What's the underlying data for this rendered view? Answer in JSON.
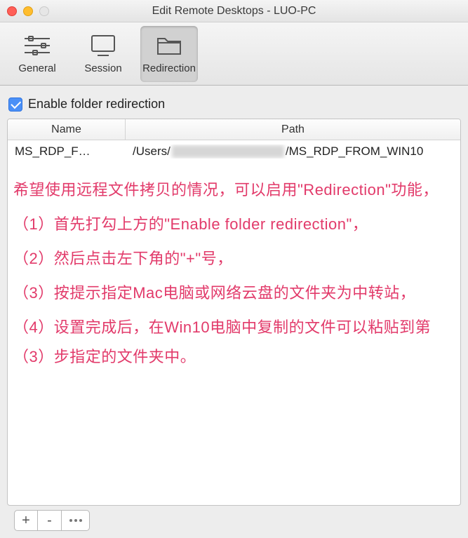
{
  "window": {
    "title": "Edit Remote Desktops - LUO-PC"
  },
  "toolbar": {
    "items": [
      {
        "label": "General"
      },
      {
        "label": "Session"
      },
      {
        "label": "Redirection"
      }
    ]
  },
  "panel": {
    "enable_checkbox": {
      "checked": true,
      "label": "Enable folder redirection"
    },
    "columns": {
      "name": "Name",
      "path": "Path"
    },
    "rows": [
      {
        "name": "MS_RDP_F…",
        "path_prefix": "/Users/",
        "path_suffix": "/MS_RDP_FROM_WIN10"
      }
    ]
  },
  "annotations": {
    "line1": "希望使用远程文件拷贝的情况，可以启用\"Redirection\"功能，",
    "line2": "（1）首先打勾上方的\"Enable folder redirection\"，",
    "line3": "（2）然后点击左下角的\"+\"号，",
    "line4": "（3）按提示指定Mac电脑或网络云盘的文件夹为中转站，",
    "line5": "（4）设置完成后，在Win10电脑中复制的文件可以粘贴到第（3）步指定的文件夹中。"
  },
  "footer": {
    "add": "+",
    "remove": "-"
  }
}
